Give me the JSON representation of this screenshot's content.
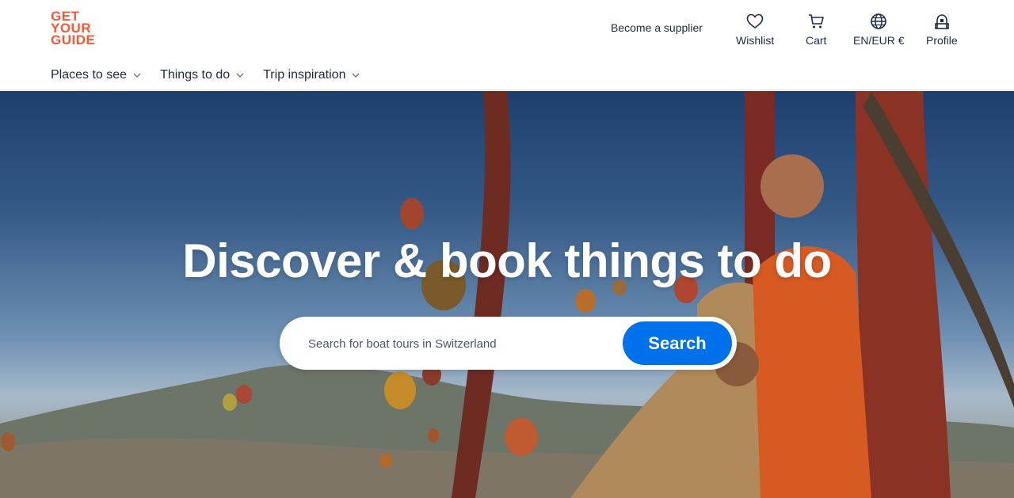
{
  "brand": {
    "logo_lines": [
      "GET",
      "YOUR",
      "GUIDE"
    ],
    "accent_color": "#ff5533"
  },
  "header": {
    "supplier_link": "Become a supplier",
    "actions": [
      {
        "label": "Wishlist",
        "icon": "heart-icon"
      },
      {
        "label": "Cart",
        "icon": "cart-icon"
      },
      {
        "label": "EN/EUR €",
        "icon": "globe-icon"
      },
      {
        "label": "Profile",
        "icon": "profile-icon"
      }
    ]
  },
  "nav": {
    "items": [
      {
        "label": "Places to see"
      },
      {
        "label": "Things to do"
      },
      {
        "label": "Trip inspiration"
      }
    ]
  },
  "hero": {
    "title": "Discover & book things to do",
    "search_placeholder": "Search for boat tours in Switzerland",
    "search_button": "Search",
    "button_color": "#0071eb"
  }
}
